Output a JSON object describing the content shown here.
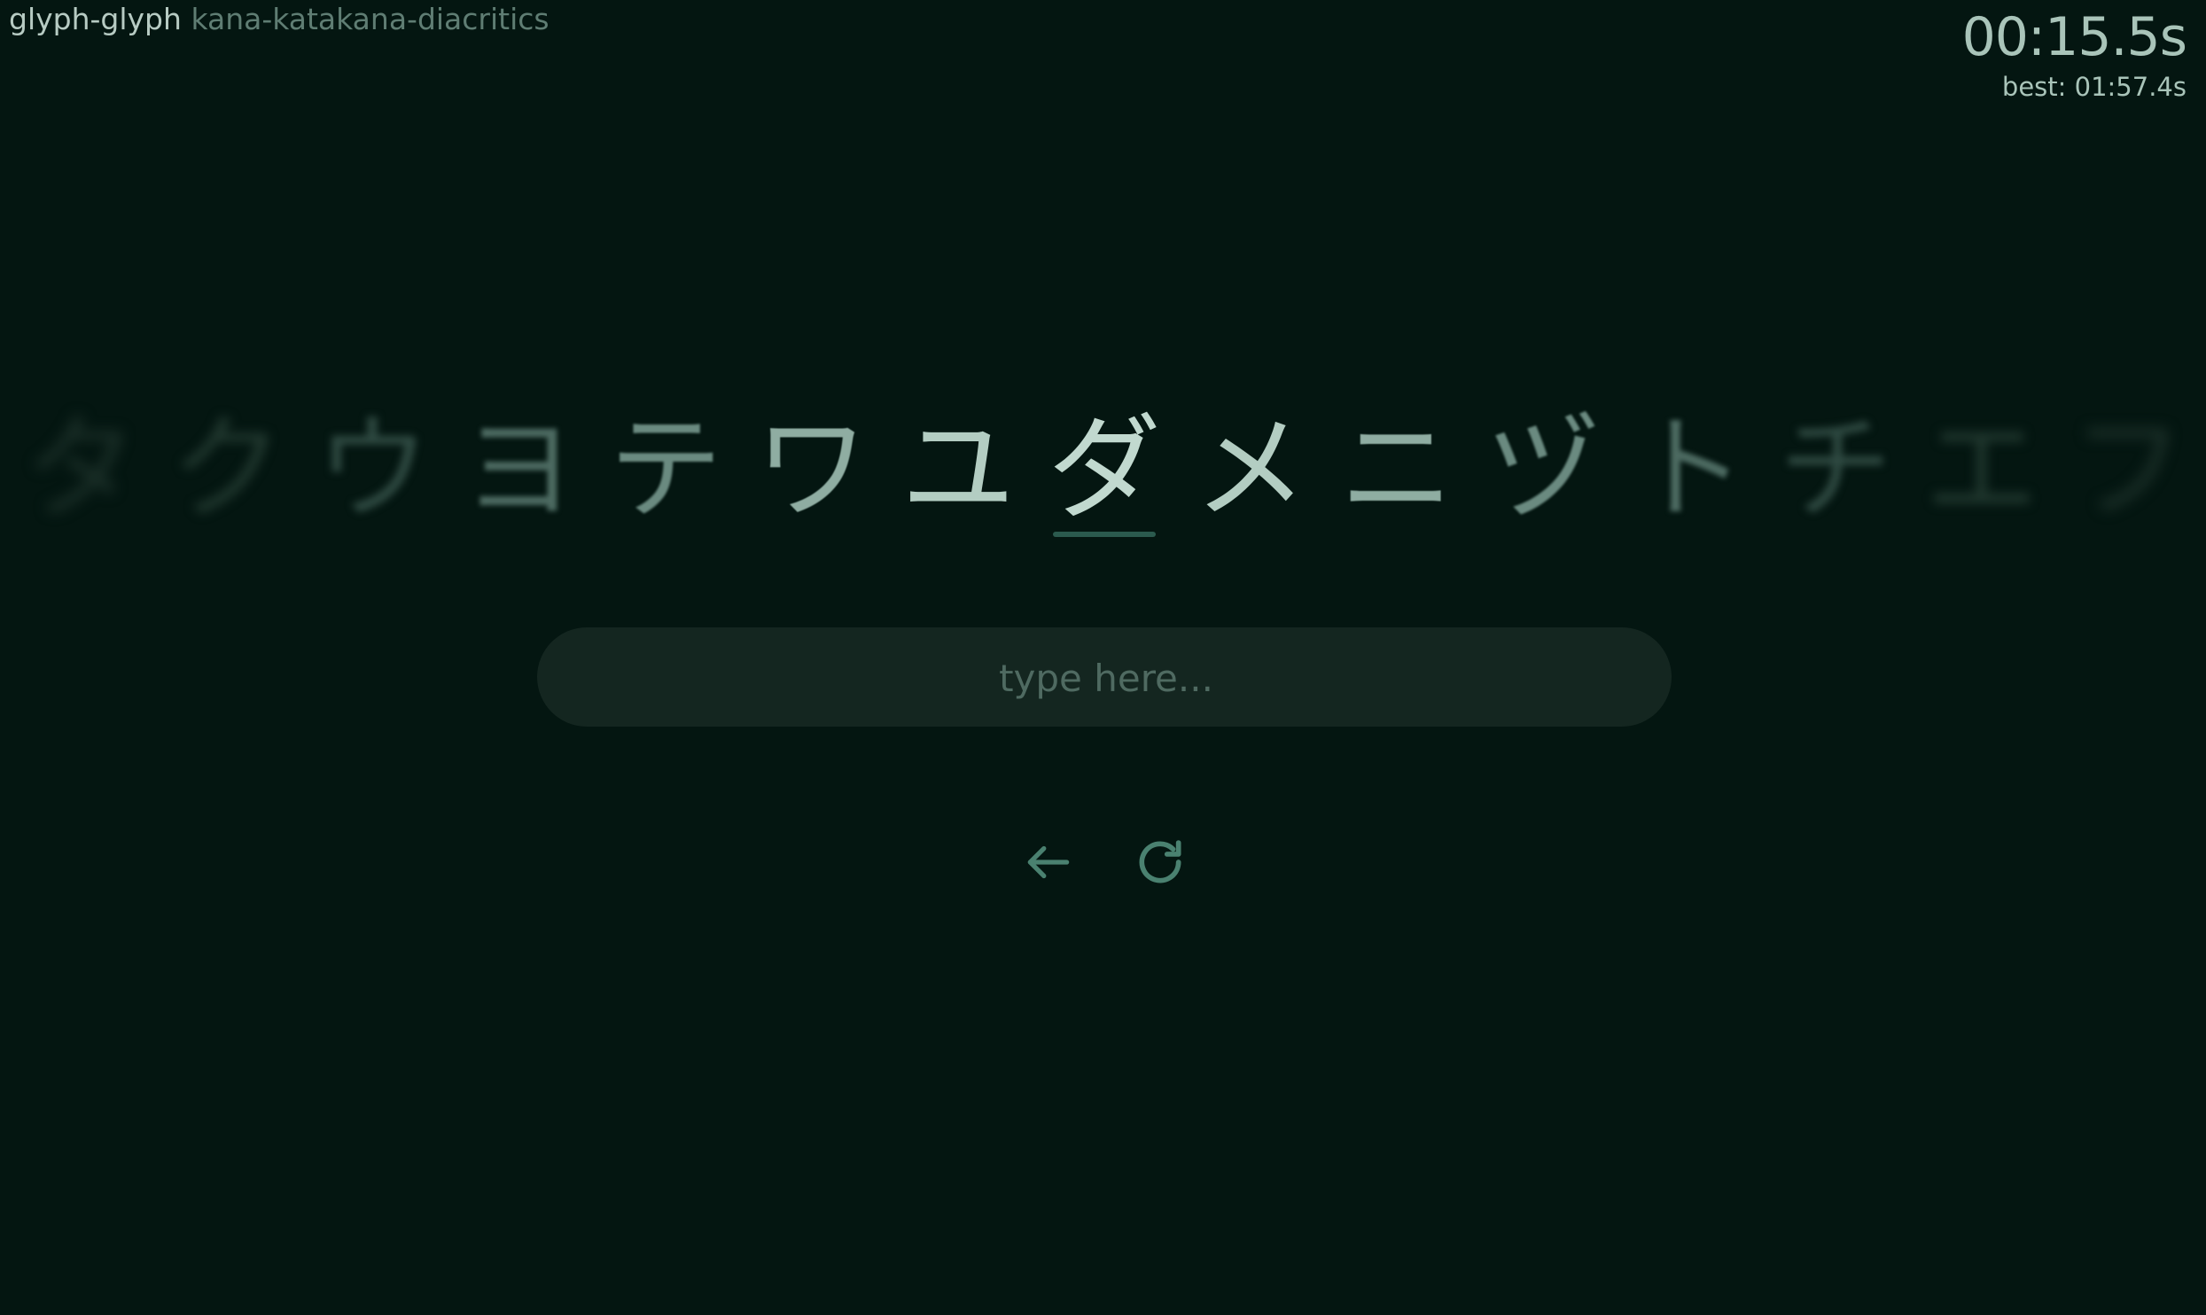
{
  "header": {
    "app_name": "glyph-glyph",
    "set_name": "kana-katakana-diacritics"
  },
  "timer": {
    "elapsed": "00:15.5s",
    "best": "best: 01:57.4s"
  },
  "glyphs": {
    "items": [
      "タ",
      "ク",
      "ウ",
      "ヨ",
      "テ",
      "ワ",
      "ユ",
      "ダ",
      "メ",
      "ニ",
      "ヅ",
      "ト",
      "チ",
      "エ",
      "フ"
    ],
    "active_index": 7
  },
  "input": {
    "placeholder": "type here...",
    "value": ""
  },
  "controls": {
    "back_icon": "arrow-left-icon",
    "restart_icon": "restart-icon"
  },
  "colors": {
    "background": "#041611",
    "active_glyph": "#c1d9cf",
    "underline": "#2b5a4e",
    "icon": "#4a8170"
  }
}
